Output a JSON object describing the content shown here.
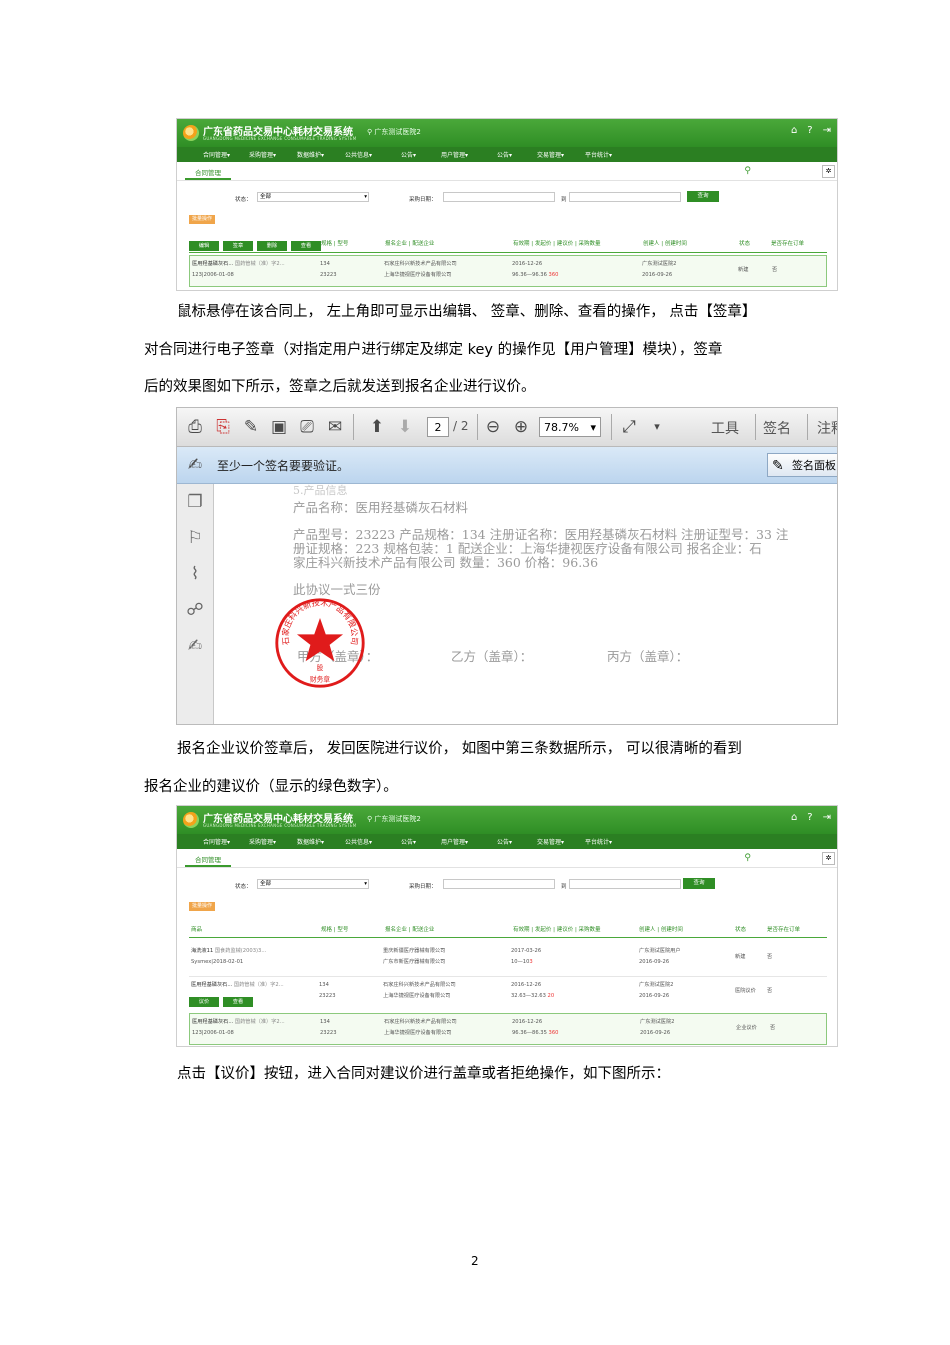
{
  "paragraphs": {
    "p1": "鼠标悬停在该合同上，  左上角即可显示出编辑、   签章、删除、查看的操作，  点击【签章】",
    "p2": "对合同进行电子签章（对指定用户进行绑定及绑定     key 的操作见【用户管理】模块），签章",
    "p3": "后的效果图如下所示，签章之后就发送到报名企业进行议价。",
    "p4": "报名企业议价签章后，    发回医院进行议价，    如图中第三条数据所示，      可以很清晰的看到",
    "p5": "报名企业的建议价（显示的绿色数字）。",
    "p6": "点击【议价】按钮，进入合同对建议价进行盖章或者拒绝操作，如下图所示："
  },
  "page_number": "2",
  "system": {
    "title": "广东省药品交易中心耗材交易系统",
    "subtitle": "GUANGDONG MEDICINE EXCHANGE CONSUMABLE TRADING SYSTEM",
    "location": "广东测试医院2",
    "nav": [
      "合同管理▾",
      "采购管理▾",
      "数据维护▾",
      "公共信息▾",
      "公告▾",
      "用户管理▾",
      "公告▾",
      "交易管理▾",
      "平台统计▾"
    ],
    "tab": "合同管理",
    "status_label": "状态：",
    "status_value": "全部",
    "date_label": "采购日期：",
    "to_label": "到",
    "query": "查询",
    "batch": "批量操作",
    "hover_buttons": [
      "编辑",
      "签章",
      "删除",
      "查看"
    ],
    "headers": [
      "商品",
      "规格 | 型号",
      "报名企业 | 配送企业",
      "有效期 | 发起价 | 建议价 | 采购数量",
      "创建人 | 创建时间",
      "状态",
      "是否存在订单"
    ],
    "row_a": {
      "product": "医用羟基磷灰石...",
      "cert": "国药管械（准）字2...",
      "code": "123|2006-01-08",
      "spec": "134",
      "model": "23223",
      "company": "石家庄科兴新技术产品有限公司",
      "dist": "上海华捷视医疗设备有限公司",
      "date": "2016-12-26",
      "price": "96.36—96.36",
      "qty": "360",
      "creator": "广东测试医院2",
      "ctime": "2016-09-26",
      "status": "新建",
      "order": "否"
    },
    "row_b1": {
      "product": "海洗液11",
      "cert": "国食药监械(2003)3...",
      "code": "Sysmex|2018-02-01",
      "company": "重庆新疆医疗器械有限公司",
      "dist": "广东市新医疗器械有限公司",
      "date": "2017-03-26",
      "price": "10—10",
      "qty": "3",
      "creator": "广东测试医院用户",
      "ctime": "2016-09-26",
      "status": "新建",
      "order": "否"
    },
    "row_b2": {
      "product": "医用羟基磷灰石...",
      "cert": "国药管械（准）字2...",
      "code": "",
      "spec": "134",
      "model": "23223",
      "company": "石家庄科兴新技术产品有限公司",
      "dist": "上海华捷视医疗设备有限公司",
      "date": "2016-12-26",
      "price": "32.63—32.63",
      "qty": "20",
      "creator": "广东测试医院2",
      "ctime": "2016-09-26",
      "status": "医院议价",
      "order": "否",
      "buttons": [
        "议价",
        "查看"
      ]
    },
    "row_b3": {
      "product": "医用羟基磷灰石...",
      "cert": "国药管械（准）字2...",
      "code": "123|2006-01-08",
      "spec": "134",
      "model": "23223",
      "company": "石家庄科兴新技术产品有限公司",
      "dist": "上海华捷视医疗设备有限公司",
      "date": "2016-12-26",
      "price": "96.36—86.35",
      "qty": "360",
      "creator": "广东测试医院2",
      "ctime": "2016-09-26",
      "status": "企业议价",
      "order": "否"
    }
  },
  "pdf": {
    "page_current": "2",
    "page_total": "/ 2",
    "zoom": "78.7%",
    "tools": "工具",
    "sign": "签名",
    "comment": "注释",
    "message": "至少一个签名要要验证。",
    "sign_panel": "签名面板",
    "line0": "5.产品信息",
    "line1": "产品名称：医用羟基磷灰石材料",
    "line2": "产品型号：23223 产品规格：134 注册证名称：医用羟基磷灰石材料 注册证型号：33 注",
    "line3": "册证规格：223 规格包装：1 配送企业：上海华捷视医疗设备有限公司 报名企业：石",
    "line4": "家庄科兴新技术产品有限公司 数量：360 价格：96.36",
    "line5": "此协议一式三份",
    "party_a": "甲方（盖章）：",
    "party_b": "乙方（盖章）：",
    "party_c": "丙方（盖章）：",
    "seal_text": "石家庄科兴新技术产品有限公司",
    "seal_bottom": "财务章",
    "seal_mid": "股"
  },
  "colors": {
    "header_green": "#2f8e25",
    "seal_red": "#e01b1b",
    "price_red": "#e33333"
  }
}
